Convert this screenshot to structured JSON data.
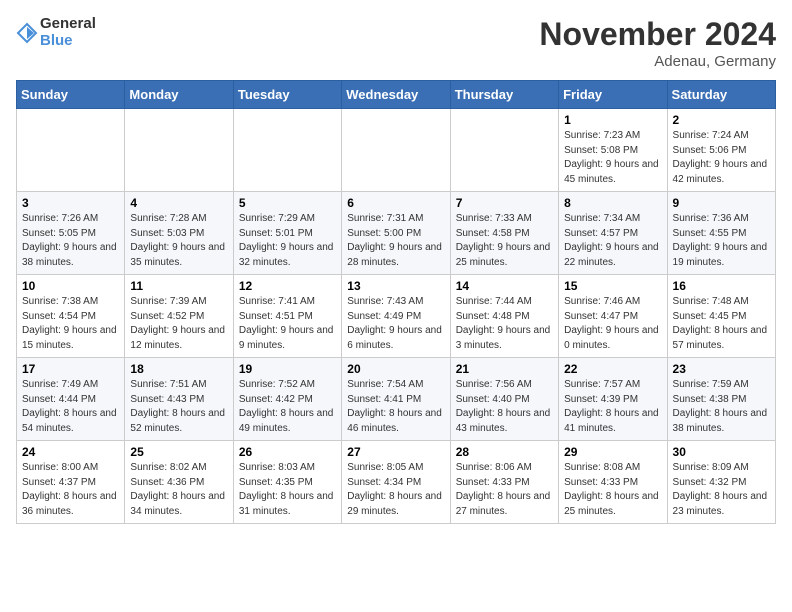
{
  "logo": {
    "line1": "General",
    "line2": "Blue"
  },
  "title": "November 2024",
  "location": "Adenau, Germany",
  "weekdays": [
    "Sunday",
    "Monday",
    "Tuesday",
    "Wednesday",
    "Thursday",
    "Friday",
    "Saturday"
  ],
  "weeks": [
    [
      {
        "day": "",
        "info": ""
      },
      {
        "day": "",
        "info": ""
      },
      {
        "day": "",
        "info": ""
      },
      {
        "day": "",
        "info": ""
      },
      {
        "day": "",
        "info": ""
      },
      {
        "day": "1",
        "info": "Sunrise: 7:23 AM\nSunset: 5:08 PM\nDaylight: 9 hours and 45 minutes."
      },
      {
        "day": "2",
        "info": "Sunrise: 7:24 AM\nSunset: 5:06 PM\nDaylight: 9 hours and 42 minutes."
      }
    ],
    [
      {
        "day": "3",
        "info": "Sunrise: 7:26 AM\nSunset: 5:05 PM\nDaylight: 9 hours and 38 minutes."
      },
      {
        "day": "4",
        "info": "Sunrise: 7:28 AM\nSunset: 5:03 PM\nDaylight: 9 hours and 35 minutes."
      },
      {
        "day": "5",
        "info": "Sunrise: 7:29 AM\nSunset: 5:01 PM\nDaylight: 9 hours and 32 minutes."
      },
      {
        "day": "6",
        "info": "Sunrise: 7:31 AM\nSunset: 5:00 PM\nDaylight: 9 hours and 28 minutes."
      },
      {
        "day": "7",
        "info": "Sunrise: 7:33 AM\nSunset: 4:58 PM\nDaylight: 9 hours and 25 minutes."
      },
      {
        "day": "8",
        "info": "Sunrise: 7:34 AM\nSunset: 4:57 PM\nDaylight: 9 hours and 22 minutes."
      },
      {
        "day": "9",
        "info": "Sunrise: 7:36 AM\nSunset: 4:55 PM\nDaylight: 9 hours and 19 minutes."
      }
    ],
    [
      {
        "day": "10",
        "info": "Sunrise: 7:38 AM\nSunset: 4:54 PM\nDaylight: 9 hours and 15 minutes."
      },
      {
        "day": "11",
        "info": "Sunrise: 7:39 AM\nSunset: 4:52 PM\nDaylight: 9 hours and 12 minutes."
      },
      {
        "day": "12",
        "info": "Sunrise: 7:41 AM\nSunset: 4:51 PM\nDaylight: 9 hours and 9 minutes."
      },
      {
        "day": "13",
        "info": "Sunrise: 7:43 AM\nSunset: 4:49 PM\nDaylight: 9 hours and 6 minutes."
      },
      {
        "day": "14",
        "info": "Sunrise: 7:44 AM\nSunset: 4:48 PM\nDaylight: 9 hours and 3 minutes."
      },
      {
        "day": "15",
        "info": "Sunrise: 7:46 AM\nSunset: 4:47 PM\nDaylight: 9 hours and 0 minutes."
      },
      {
        "day": "16",
        "info": "Sunrise: 7:48 AM\nSunset: 4:45 PM\nDaylight: 8 hours and 57 minutes."
      }
    ],
    [
      {
        "day": "17",
        "info": "Sunrise: 7:49 AM\nSunset: 4:44 PM\nDaylight: 8 hours and 54 minutes."
      },
      {
        "day": "18",
        "info": "Sunrise: 7:51 AM\nSunset: 4:43 PM\nDaylight: 8 hours and 52 minutes."
      },
      {
        "day": "19",
        "info": "Sunrise: 7:52 AM\nSunset: 4:42 PM\nDaylight: 8 hours and 49 minutes."
      },
      {
        "day": "20",
        "info": "Sunrise: 7:54 AM\nSunset: 4:41 PM\nDaylight: 8 hours and 46 minutes."
      },
      {
        "day": "21",
        "info": "Sunrise: 7:56 AM\nSunset: 4:40 PM\nDaylight: 8 hours and 43 minutes."
      },
      {
        "day": "22",
        "info": "Sunrise: 7:57 AM\nSunset: 4:39 PM\nDaylight: 8 hours and 41 minutes."
      },
      {
        "day": "23",
        "info": "Sunrise: 7:59 AM\nSunset: 4:38 PM\nDaylight: 8 hours and 38 minutes."
      }
    ],
    [
      {
        "day": "24",
        "info": "Sunrise: 8:00 AM\nSunset: 4:37 PM\nDaylight: 8 hours and 36 minutes."
      },
      {
        "day": "25",
        "info": "Sunrise: 8:02 AM\nSunset: 4:36 PM\nDaylight: 8 hours and 34 minutes."
      },
      {
        "day": "26",
        "info": "Sunrise: 8:03 AM\nSunset: 4:35 PM\nDaylight: 8 hours and 31 minutes."
      },
      {
        "day": "27",
        "info": "Sunrise: 8:05 AM\nSunset: 4:34 PM\nDaylight: 8 hours and 29 minutes."
      },
      {
        "day": "28",
        "info": "Sunrise: 8:06 AM\nSunset: 4:33 PM\nDaylight: 8 hours and 27 minutes."
      },
      {
        "day": "29",
        "info": "Sunrise: 8:08 AM\nSunset: 4:33 PM\nDaylight: 8 hours and 25 minutes."
      },
      {
        "day": "30",
        "info": "Sunrise: 8:09 AM\nSunset: 4:32 PM\nDaylight: 8 hours and 23 minutes."
      }
    ]
  ]
}
